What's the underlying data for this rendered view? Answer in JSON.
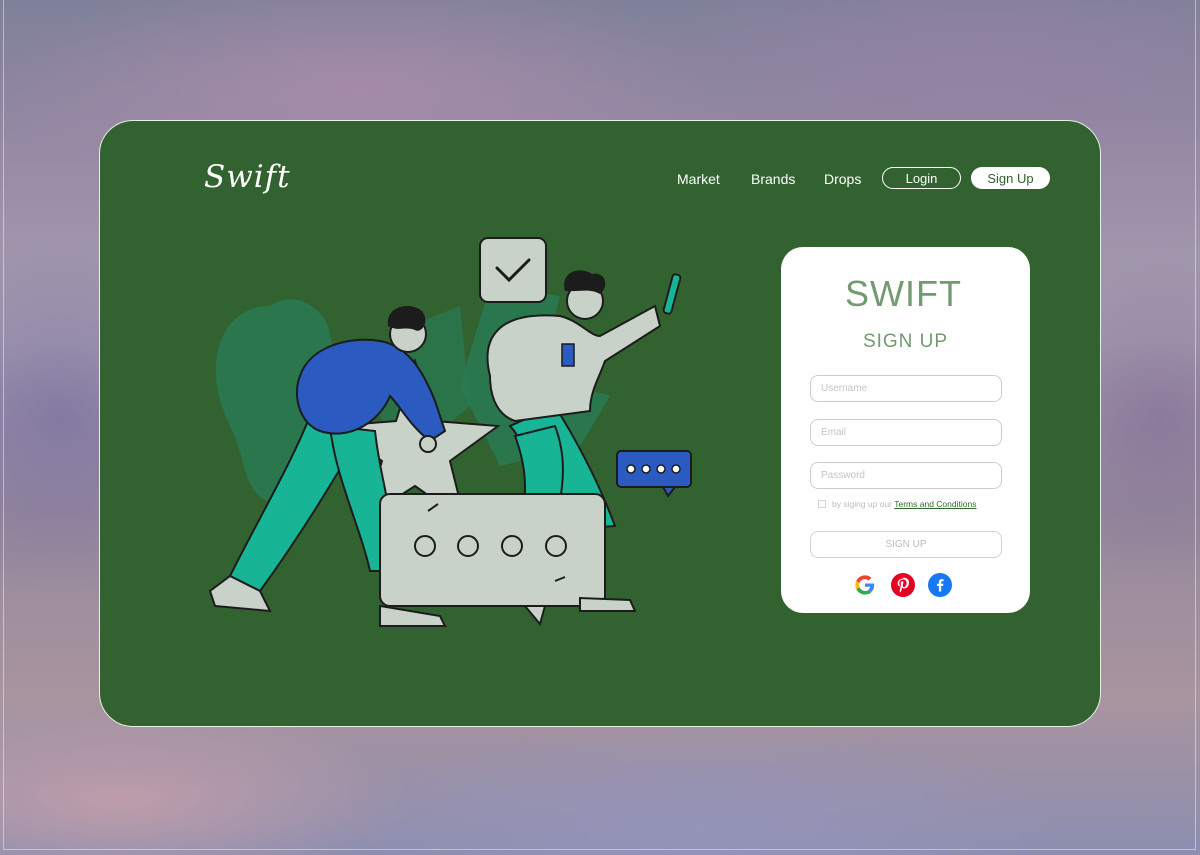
{
  "brand": {
    "logo": "Swift"
  },
  "nav": {
    "items": [
      {
        "label": "Market"
      },
      {
        "label": "Brands"
      },
      {
        "label": "Drops"
      }
    ],
    "login_label": "Login",
    "signup_label": "Sign Up"
  },
  "form": {
    "brand": "SWIFT",
    "title": "SIGN UP",
    "username_placeholder": "Username",
    "email_placeholder": "Email",
    "password_placeholder": "Password",
    "terms_text": "by siging up our",
    "terms_link": "Terms and Conditions",
    "submit_label": "SIGN UP",
    "social": [
      {
        "icon": "google-icon",
        "color": "#4285F4"
      },
      {
        "icon": "pinterest-icon",
        "color": "#E60023"
      },
      {
        "icon": "facebook-icon",
        "color": "#1877F2"
      }
    ]
  },
  "colors": {
    "card_bg": "#336231",
    "accent_green": "#749a72",
    "illustration_blue": "#2b5bc0",
    "illustration_teal": "#17b495",
    "illustration_gray": "#c9d2c9"
  }
}
